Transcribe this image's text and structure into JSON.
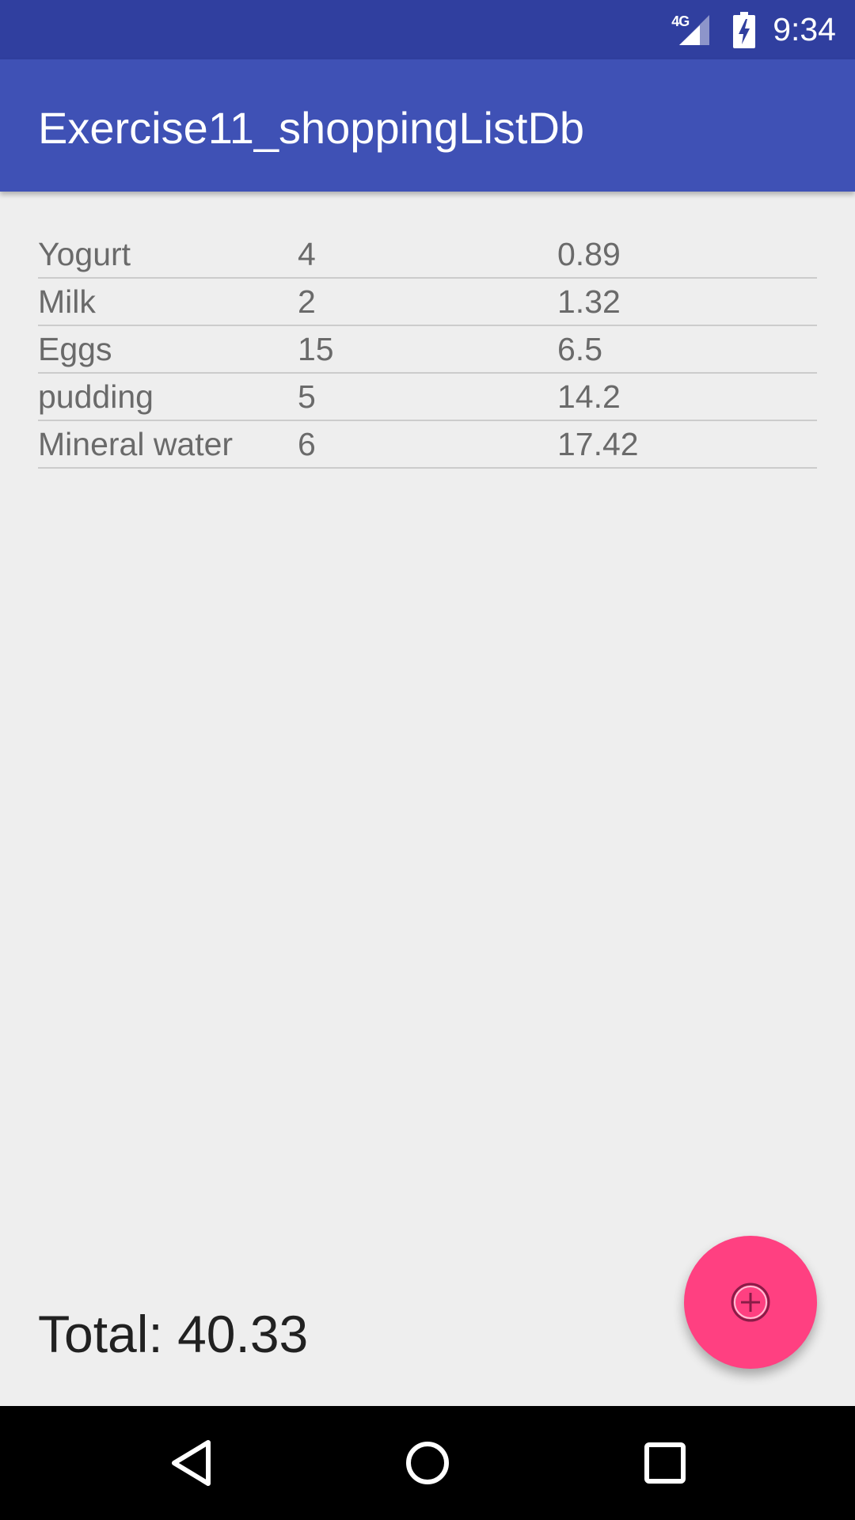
{
  "status_bar": {
    "network_label": "4G",
    "time": "9:34"
  },
  "app_bar": {
    "title": "Exercise11_shoppingListDb"
  },
  "items": [
    {
      "name": "Yogurt",
      "quantity": "4",
      "price": "0.89"
    },
    {
      "name": "Milk",
      "quantity": "2",
      "price": "1.32"
    },
    {
      "name": "Eggs",
      "quantity": "15",
      "price": "6.5"
    },
    {
      "name": "pudding",
      "quantity": "5",
      "price": "14.2"
    },
    {
      "name": "Mineral water",
      "quantity": "6",
      "price": "17.42"
    }
  ],
  "total": {
    "label": "Total: 40.33"
  },
  "fab": {
    "icon": "add-circle-icon"
  },
  "navigation": {
    "back_icon": "back-triangle-icon",
    "home_icon": "home-circle-icon",
    "recents_icon": "recents-square-icon"
  },
  "colors": {
    "status_bar": "#303f9f",
    "app_bar": "#3f51b5",
    "accent": "#ff4081",
    "background": "#eeeeee"
  }
}
